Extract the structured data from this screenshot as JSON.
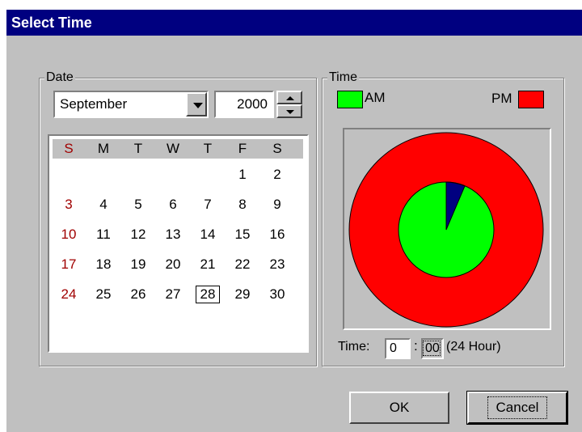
{
  "window": {
    "title": "Select Time"
  },
  "date_group": {
    "label": "Date",
    "month": "September",
    "year": "2000",
    "day_headers": [
      "S",
      "M",
      "T",
      "W",
      "T",
      "F",
      "S"
    ],
    "weeks": [
      [
        "",
        "",
        "",
        "",
        "",
        "1",
        "2"
      ],
      [
        "3",
        "4",
        "5",
        "6",
        "7",
        "8",
        "9"
      ],
      [
        "10",
        "11",
        "12",
        "13",
        "14",
        "15",
        "16"
      ],
      [
        "17",
        "18",
        "19",
        "20",
        "21",
        "22",
        "23"
      ],
      [
        "24",
        "25",
        "26",
        "27",
        "28",
        "29",
        "30"
      ]
    ],
    "selected_day": "28"
  },
  "time_group": {
    "label": "Time",
    "am_label": "AM",
    "pm_label": "PM",
    "time_label": "Time:",
    "hour": "0",
    "minute": "00",
    "format_note": "(24 Hour)"
  },
  "colors": {
    "am": "#00ff00",
    "pm": "#ff0000",
    "hand": "#000080",
    "titlebar": "#000080",
    "sunday": "#a00000"
  },
  "buttons": {
    "ok": "OK",
    "cancel": "Cancel"
  }
}
